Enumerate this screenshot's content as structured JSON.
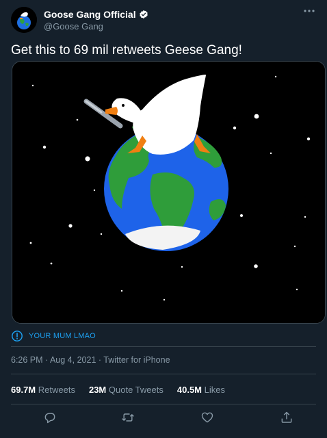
{
  "header": {
    "display_name": "Goose Gang Official",
    "handle": "@Goose Gang",
    "more_icon": "more-dots-icon"
  },
  "tweet": {
    "text": "Get this to 69 mil retweets Geese Gang!"
  },
  "notice": {
    "icon": "exclamation-circle-icon",
    "text": "YOUR MUM LMAO"
  },
  "meta": {
    "time": "6:26 PM · Aug 4, 2021 · Twitter for iPhone"
  },
  "stats": {
    "retweets_count": "69.7M",
    "retweets_label": "Retweets",
    "quotes_count": "23M",
    "quotes_label": "Quote Tweets",
    "likes_count": "40.5M",
    "likes_label": "Likes"
  },
  "actions": [
    "reply-icon",
    "retweet-icon",
    "like-icon",
    "share-icon"
  ],
  "colors": {
    "background": "#15202b",
    "accent": "#1da1f2",
    "secondary_text": "#8899a6",
    "border": "#38444d"
  }
}
